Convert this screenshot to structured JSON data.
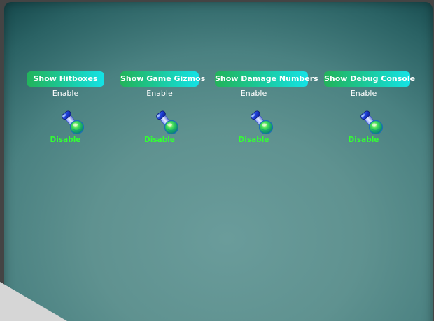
{
  "toggles": [
    {
      "button_label": "Show Hitboxes",
      "enable_label": "Enable",
      "disable_label": "Disable",
      "icon": "toggle-knob-icon"
    },
    {
      "button_label": "Show Game Gizmos",
      "enable_label": "Enable",
      "disable_label": "Disable",
      "icon": "toggle-knob-icon"
    },
    {
      "button_label": "Show Damage Numbers",
      "enable_label": "Enable",
      "disable_label": "Disable",
      "icon": "toggle-knob-icon"
    },
    {
      "button_label": "Show Debug Console",
      "enable_label": "Enable",
      "disable_label": "Disable",
      "icon": "toggle-knob-icon"
    }
  ],
  "colors": {
    "button_gradient_start": "#22b35a",
    "button_gradient_end": "#14e2e6",
    "disable_text": "#33ff33",
    "enable_text": "#ffffff",
    "panel_center": "#6a9c9b",
    "panel_edge": "#0e3f43"
  }
}
